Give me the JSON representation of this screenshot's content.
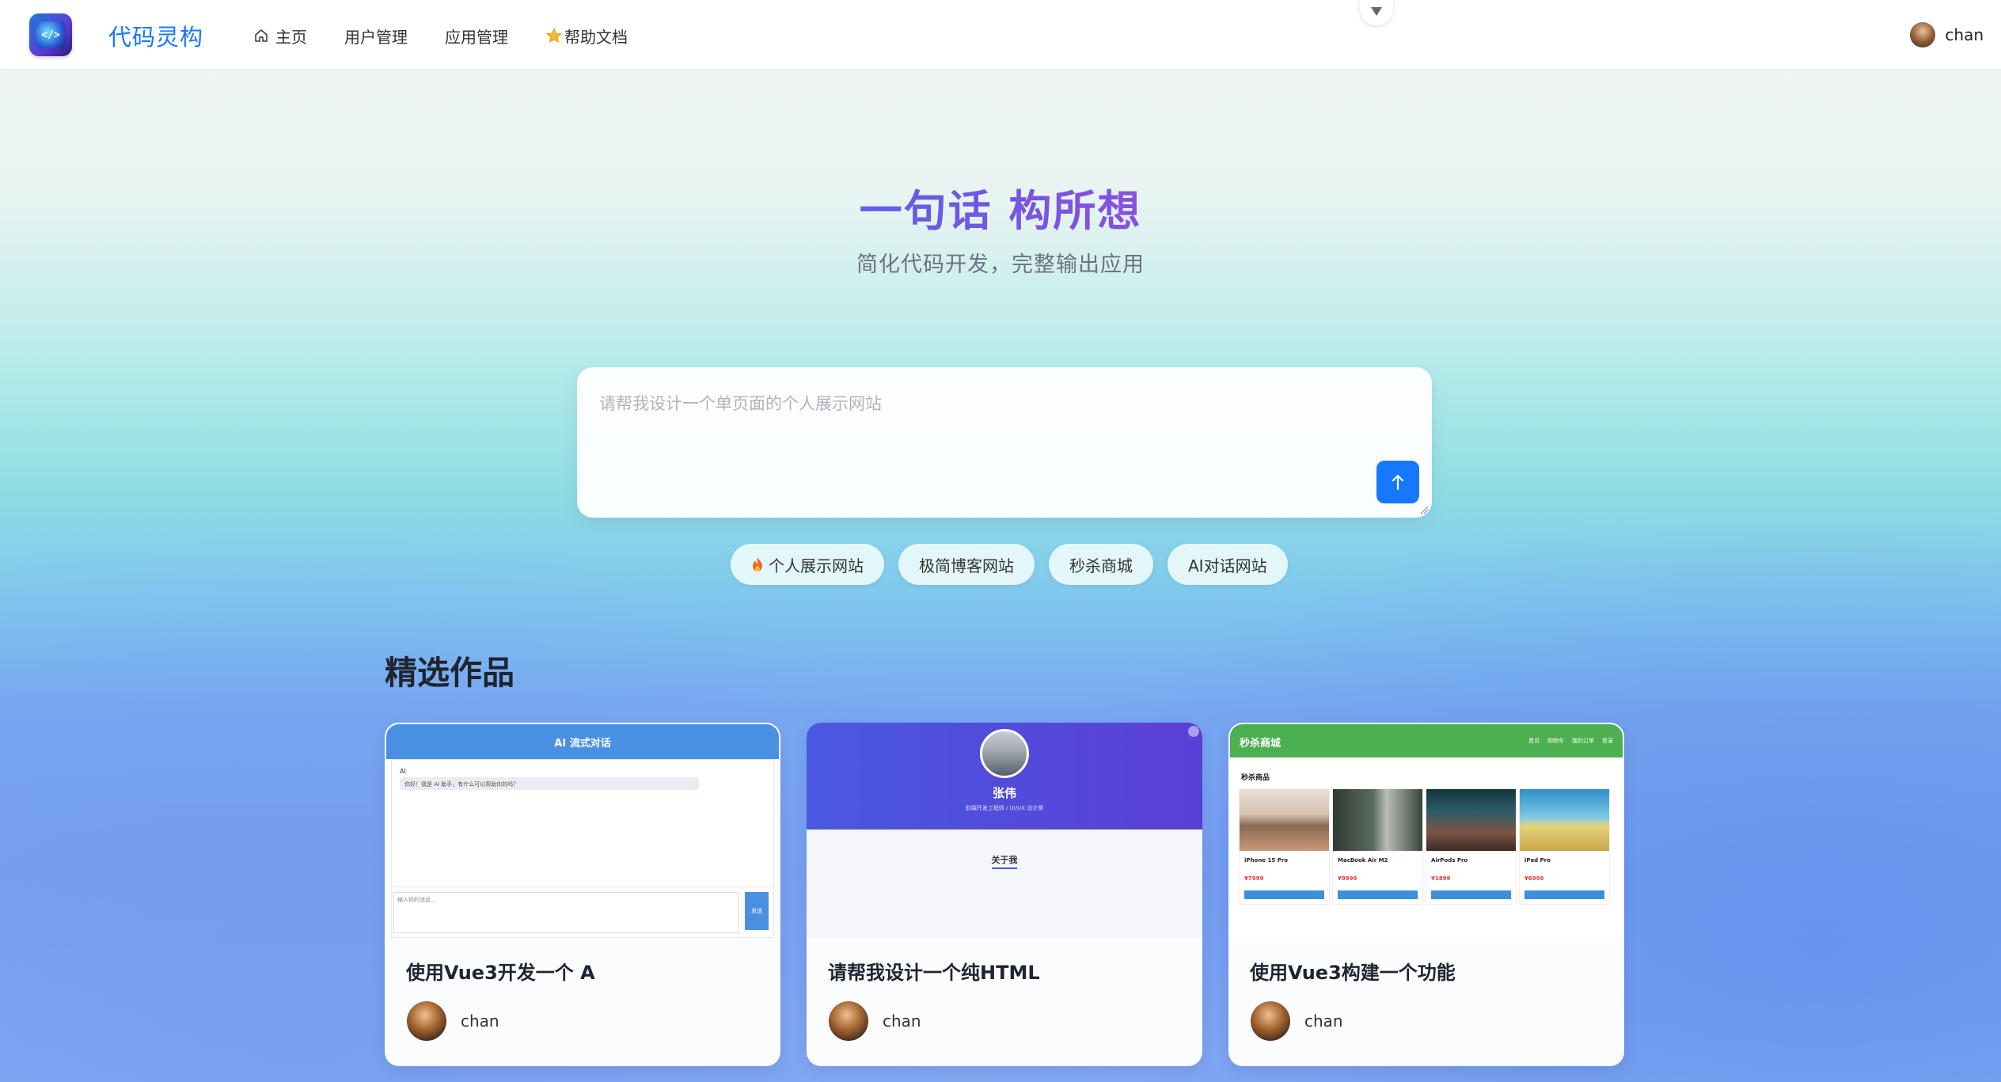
{
  "header": {
    "app_name": "代码灵构",
    "nav": [
      {
        "label": "主页",
        "icon": "home-icon"
      },
      {
        "label": "用户管理"
      },
      {
        "label": "应用管理"
      },
      {
        "label": "帮助文档",
        "icon": "star-icon"
      }
    ],
    "user_name": "chan"
  },
  "hero": {
    "title": "一句话 构所想",
    "subtitle": "简化代码开发，完整输出应用"
  },
  "prompt": {
    "placeholder": "请帮我设计一个单页面的个人展示网站",
    "value": ""
  },
  "quick_tags": [
    {
      "label": "个人展示网站",
      "icon": "fire-icon"
    },
    {
      "label": "极简博客网站"
    },
    {
      "label": "秒杀商城"
    },
    {
      "label": "AI对话网站"
    }
  ],
  "featured": {
    "title": "精选作品",
    "cards": [
      {
        "title": "使用Vue3开发一个 A",
        "author": "chan",
        "preview": {
          "header": "AI 流式对话",
          "ai_label": "AI",
          "bubble": "你好！我是 AI 助手，有什么可以帮助你的吗？",
          "input_placeholder": "输入你的消息...",
          "send": "发送"
        }
      },
      {
        "title": "请帮我设计一个纯HTML",
        "author": "chan",
        "preview": {
          "name": "张伟",
          "role": "前端开发工程师 / UI/UX 设计师",
          "about": "关于我"
        }
      },
      {
        "title": "使用Vue3构建一个功能",
        "author": "chan",
        "preview": {
          "brand": "秒杀商城",
          "links": [
            "首页",
            "购物车",
            "我的订单",
            "登录"
          ],
          "section": "秒杀商品",
          "products": [
            {
              "name": "iPhone 15 Pro",
              "price": "¥7999"
            },
            {
              "name": "MacBook Air M2",
              "price": "¥9999"
            },
            {
              "name": "AirPods Pro",
              "price": "¥1899"
            },
            {
              "name": "iPad Pro",
              "price": "¥6999"
            }
          ]
        }
      }
    ]
  },
  "colors": {
    "primary": "#1677ff",
    "title_gradient_start": "#5f5ee6",
    "title_gradient_end": "#8a4fe0"
  }
}
